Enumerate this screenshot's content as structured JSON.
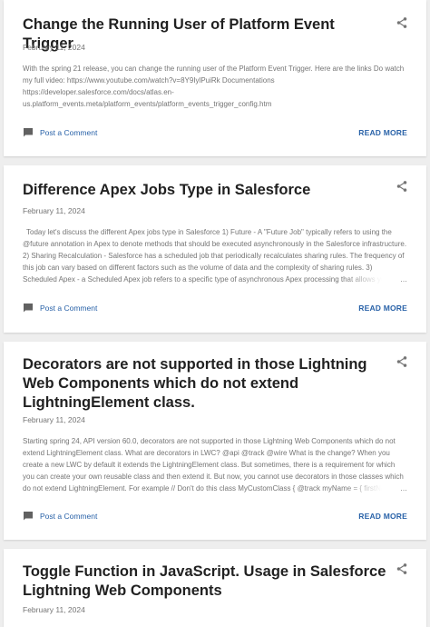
{
  "posts": [
    {
      "title": "Change the Running User of Platform Event Trigger",
      "date": "February 11, 2024",
      "snippet": "With the spring 21 release, you can change the running user of the Platform Event Trigger. Here are the links Do watch my full video: https://www.youtube.com/watch?v=8Y9IylPuiRk Documentations https://developer.salesforce.com/docs/atlas.en-us.platform_events.meta/platform_events/platform_events_trigger_config.htm",
      "comment_label": "Post a Comment",
      "read_more": "READ MORE"
    },
    {
      "title": "Difference Apex Jobs Type in Salesforce",
      "date": "February 11, 2024",
      "snippet": "Today let's discuss the different Apex jobs type in Salesforce 1) Future - A \"Future Job\" typically refers to using the @future annotation in Apex to denote methods that should be executed asynchronously in the Salesforce infrastructure. 2) Sharing Recalculation - Salesforce has a scheduled job that periodically recalculates sharing rules. The frequency of this job can vary based on different factors such as the volume of data and the complexity of sharing rules. 3) Scheduled Apex - a Scheduled Apex job refers to a specific type of asynchronous Apex processing that allows you to schedule the executi",
      "ellipsis": "…",
      "comment_label": "Post a Comment",
      "read_more": "READ MORE"
    },
    {
      "title": "Decorators are not supported in those Lightning Web Components which do not extend LightningElement class.",
      "date": "February 11, 2024",
      "snippet": "Starting spring 24, API version 60.0, decorators are not supported in those Lightning Web Components which do not extend LightningElement class. What are decorators in LWC? @api @track @wire What is the change? When you create a new LWC by default it extends the LightningElement class. But sometimes, there is a requirement for which you can create your own reusable class and then extend it. But now, you cannot use decorators in those classes which do not extend LightningElement. For example // Don't do this class MyCustomClass { @track myName = { firstName: \"\", lastName: \"\" }",
      "ellipsis": "…",
      "comment_label": "Post a Comment",
      "read_more": "READ MORE"
    },
    {
      "title": "Toggle Function in JavaScript. Usage in Salesforce Lightning Web Components",
      "date": "February 11, 2024"
    }
  ],
  "icons": {
    "share": "share-icon",
    "comment": "comment-icon"
  },
  "colors": {
    "link": "#2962a8",
    "muted": "#757575",
    "title": "#212121",
    "background": "#eeeeee"
  }
}
